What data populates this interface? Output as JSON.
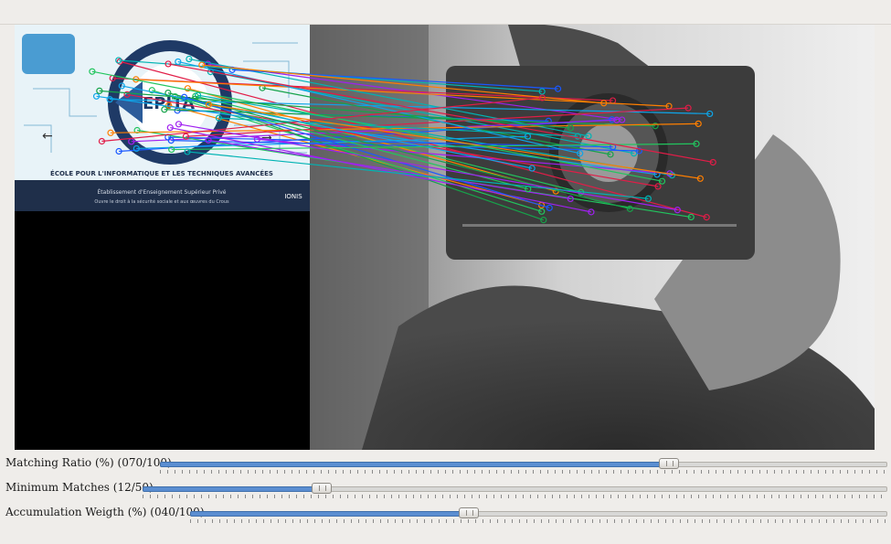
{
  "window": {
    "title": ""
  },
  "card_image": {
    "school_name": "ÉCOLE POUR L'INFORMATIQUE ET LES TECHNIQUES AVANCÉES",
    "subtitle": "Établissement d'Enseignement Supérieur Privé",
    "subtitle2": "Ouvre le droit à la sécurité sociale et aux œuvres du Crous",
    "brand": "IONIS",
    "logo": "EPITA"
  },
  "sliders": [
    {
      "label": "Matching Ratio (%) (070/100)",
      "value": 70,
      "max": 100
    },
    {
      "label": "Minimum Matches (12/50)",
      "value": 12,
      "max": 50
    },
    {
      "label": "Accumulation Weigth (%) (040/100)",
      "value": 40,
      "max": 100
    }
  ],
  "colors": {
    "accent": "#5b8ed1",
    "match_colors": [
      "#1a58ff",
      "#ff7f00",
      "#22c55e",
      "#a020f0",
      "#00b3b3",
      "#e11d48",
      "#0ea5e9",
      "#16a34a"
    ]
  }
}
